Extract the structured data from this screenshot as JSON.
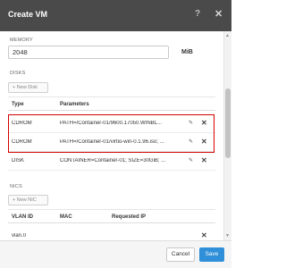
{
  "dialog": {
    "title": "Create VM",
    "help_icon": "?",
    "close_icon": "✕"
  },
  "memory": {
    "label": "MEMORY",
    "value": "2048",
    "unit": "MiB"
  },
  "disks": {
    "label": "DISKS",
    "add_button": "+ New Disk",
    "columns": [
      "Type",
      "Parameters"
    ],
    "rows": [
      {
        "type": "CDROM",
        "parameters": "PATH=/Container-01/9600.17050.WINBL..."
      },
      {
        "type": "CDROM",
        "parameters": "PATH=/Container-01/virtio-win-0.1.96.iso; ..."
      },
      {
        "type": "DISK",
        "parameters": "CONTAINER=Container-01; SIZE=30GiB; ..."
      }
    ],
    "edit_icon": "✎",
    "delete_icon": "✕"
  },
  "nics": {
    "label": "NICS",
    "add_button": "+ New NIC",
    "columns": [
      "VLAN ID",
      "MAC",
      "Requested IP"
    ],
    "rows": [
      {
        "vlan_id": "vlan.0",
        "mac": "",
        "requested_ip": ""
      }
    ],
    "delete_icon": "✕"
  },
  "footer": {
    "cancel_label": "Cancel",
    "save_label": "Save"
  },
  "colors": {
    "titlebar": "#4a4a4a",
    "accent": "#2f8fd8",
    "highlight": "#d40000"
  }
}
